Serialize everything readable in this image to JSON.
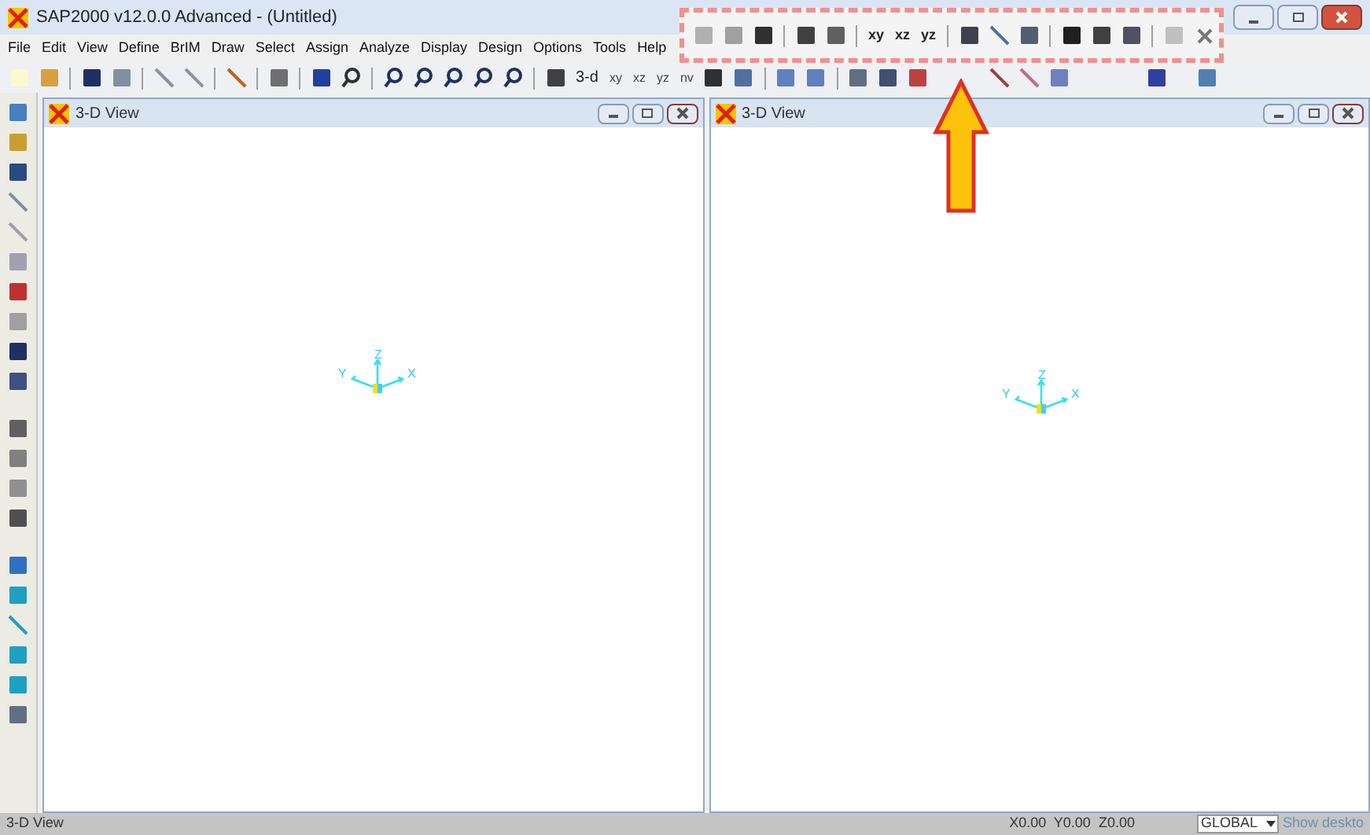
{
  "window": {
    "title": "SAP2000 v12.0.0 Advanced  - (Untitled)"
  },
  "menu": [
    "File",
    "Edit",
    "View",
    "Define",
    "BrIM",
    "Draw",
    "Select",
    "Assign",
    "Analyze",
    "Display",
    "Design",
    "Options",
    "Tools",
    "Help"
  ],
  "toolbar": {
    "view_buttons": [
      "3-d",
      "xy",
      "xz",
      "yz",
      "nv"
    ]
  },
  "floating_toolbar": {
    "view_buttons": [
      "xy",
      "xz",
      "yz"
    ]
  },
  "views": [
    {
      "title": "3-D View",
      "axes": {
        "x": "X",
        "y": "Y",
        "z": "Z"
      }
    },
    {
      "title": "3-D View",
      "axes": {
        "x": "X",
        "y": "Y",
        "z": "Z"
      }
    }
  ],
  "status_bar": {
    "view": "3-D View",
    "coordinates": "X0.00  Y0.00  Z0.00",
    "system": "GLOBAL",
    "taskbar_hint": "Show deskto"
  }
}
